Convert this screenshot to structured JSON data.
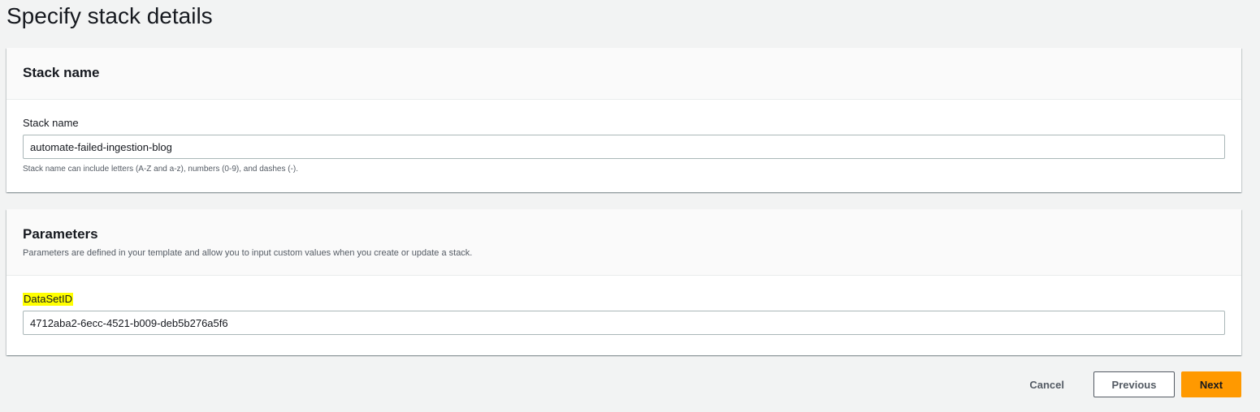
{
  "page": {
    "title": "Specify stack details"
  },
  "stack_name_panel": {
    "title": "Stack name",
    "field_label": "Stack name",
    "field_value": "automate-failed-ingestion-blog",
    "constraint": "Stack name can include letters (A-Z and a-z), numbers (0-9), and dashes (-)."
  },
  "parameters_panel": {
    "title": "Parameters",
    "description": "Parameters are defined in your template and allow you to input custom values when you create or update a stack.",
    "params": [
      {
        "label": "DataSetID",
        "value": "4712aba2-6ecc-4521-b009-deb5b276a5f6",
        "label_highlight_color": "#ffff00"
      }
    ]
  },
  "actions": {
    "cancel_label": "Cancel",
    "previous_label": "Previous",
    "next_label": "Next"
  },
  "colors": {
    "background": "#f2f3f3",
    "primary_button": "#ff9900",
    "text": "#16191f",
    "secondary_text": "#545b64"
  }
}
